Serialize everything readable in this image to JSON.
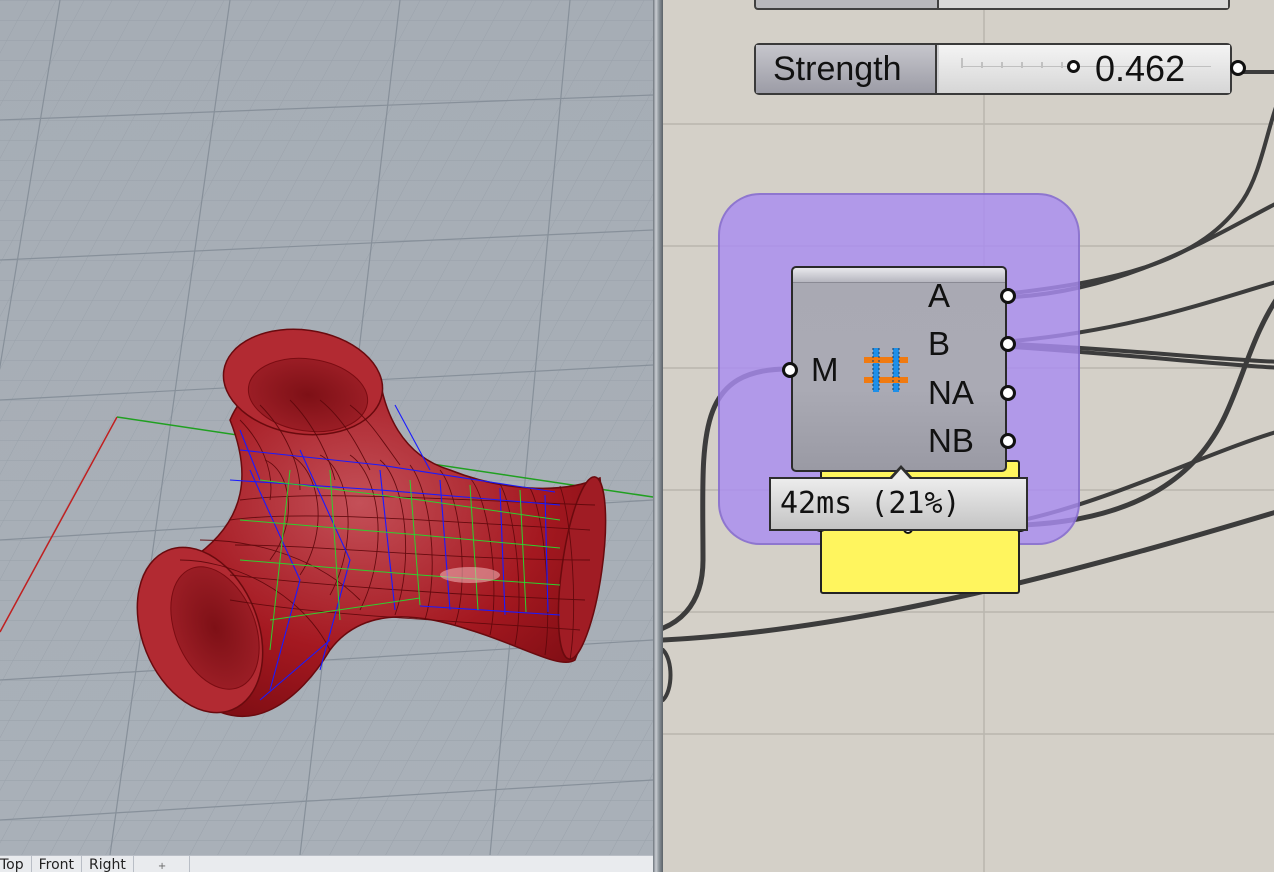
{
  "viewport": {
    "tabs": [
      {
        "label": "Top"
      },
      {
        "label": "Front"
      },
      {
        "label": "Right"
      }
    ],
    "add_tab_icon": "plus-icon",
    "colors": {
      "background": "#a9b0b8",
      "grid": "#8f979f",
      "surface": "#b0121a",
      "wire_blue": "#1a1aff",
      "wire_green": "#1faa1f",
      "axis_x": "#c02020",
      "axis_y": "#20a020"
    }
  },
  "canvas": {
    "slider": {
      "name": "Strength",
      "value": "0.462",
      "fraction": 0.462
    },
    "component": {
      "inputs": [
        {
          "label": "M"
        }
      ],
      "outputs": [
        {
          "label": "A"
        },
        {
          "label": "B"
        },
        {
          "label": "NA"
        },
        {
          "label": "NB"
        }
      ],
      "icon": "weave-grid-icon"
    },
    "profiler": {
      "text": "42ms (21%)"
    },
    "colors": {
      "background": "#d4d0c8",
      "group": "#aa8cf0",
      "panel": "#fff55e",
      "wire": "#3c3c3c"
    }
  }
}
